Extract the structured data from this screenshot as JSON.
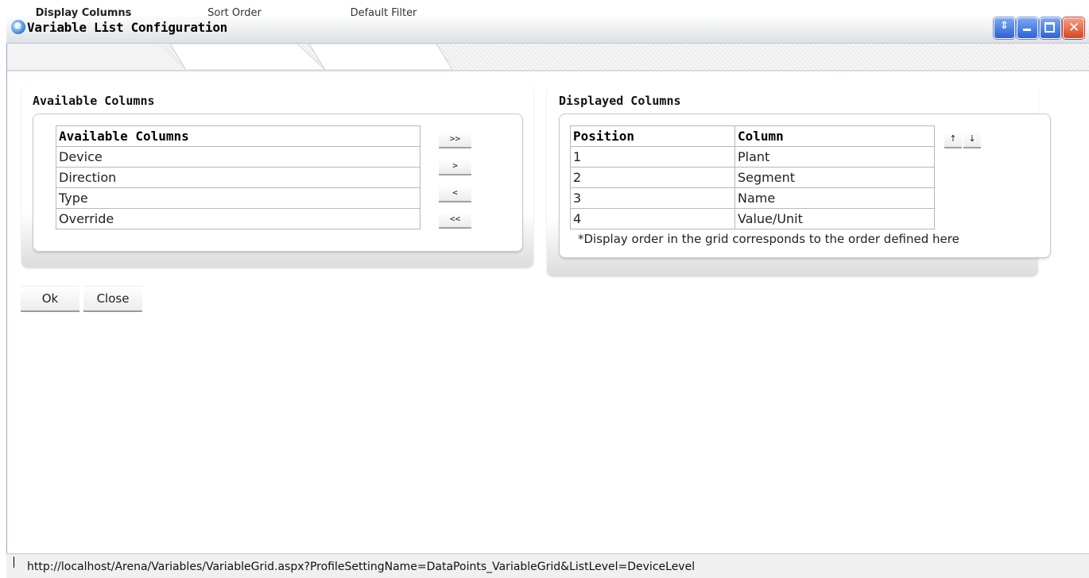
{
  "window": {
    "title": "Variable List Configuration",
    "buttons": [
      "restore-icon",
      "minimize-icon",
      "maximize-icon",
      "close-icon"
    ]
  },
  "tabs": [
    {
      "label": "Display Columns",
      "active": true
    },
    {
      "label": "Sort Order",
      "active": false
    },
    {
      "label": "Default Filter",
      "active": false
    }
  ],
  "available": {
    "panel_title": "Available Columns",
    "header": "Available Columns",
    "rows": [
      "Device",
      "Direction",
      "Type",
      "Override"
    ],
    "move_buttons": [
      ">>",
      ">",
      "<",
      "<<"
    ]
  },
  "displayed": {
    "panel_title": "Displayed Columns",
    "headers": [
      "Position",
      "Column"
    ],
    "rows": [
      {
        "position": "1",
        "column": "Plant"
      },
      {
        "position": "2",
        "column": "Segment"
      },
      {
        "position": "3",
        "column": "Name"
      },
      {
        "position": "4",
        "column": "Value/Unit"
      }
    ],
    "up_label": "↑",
    "down_label": "↓",
    "note": "*Display order in the grid corresponds to the order defined here"
  },
  "actions": {
    "ok_label": "Ok",
    "close_label": "Close"
  },
  "status": {
    "url": "http://localhost/Arena/Variables/VariableGrid.aspx?ProfileSettingName=DataPoints_VariableGrid&ListLevel=DeviceLevel"
  }
}
